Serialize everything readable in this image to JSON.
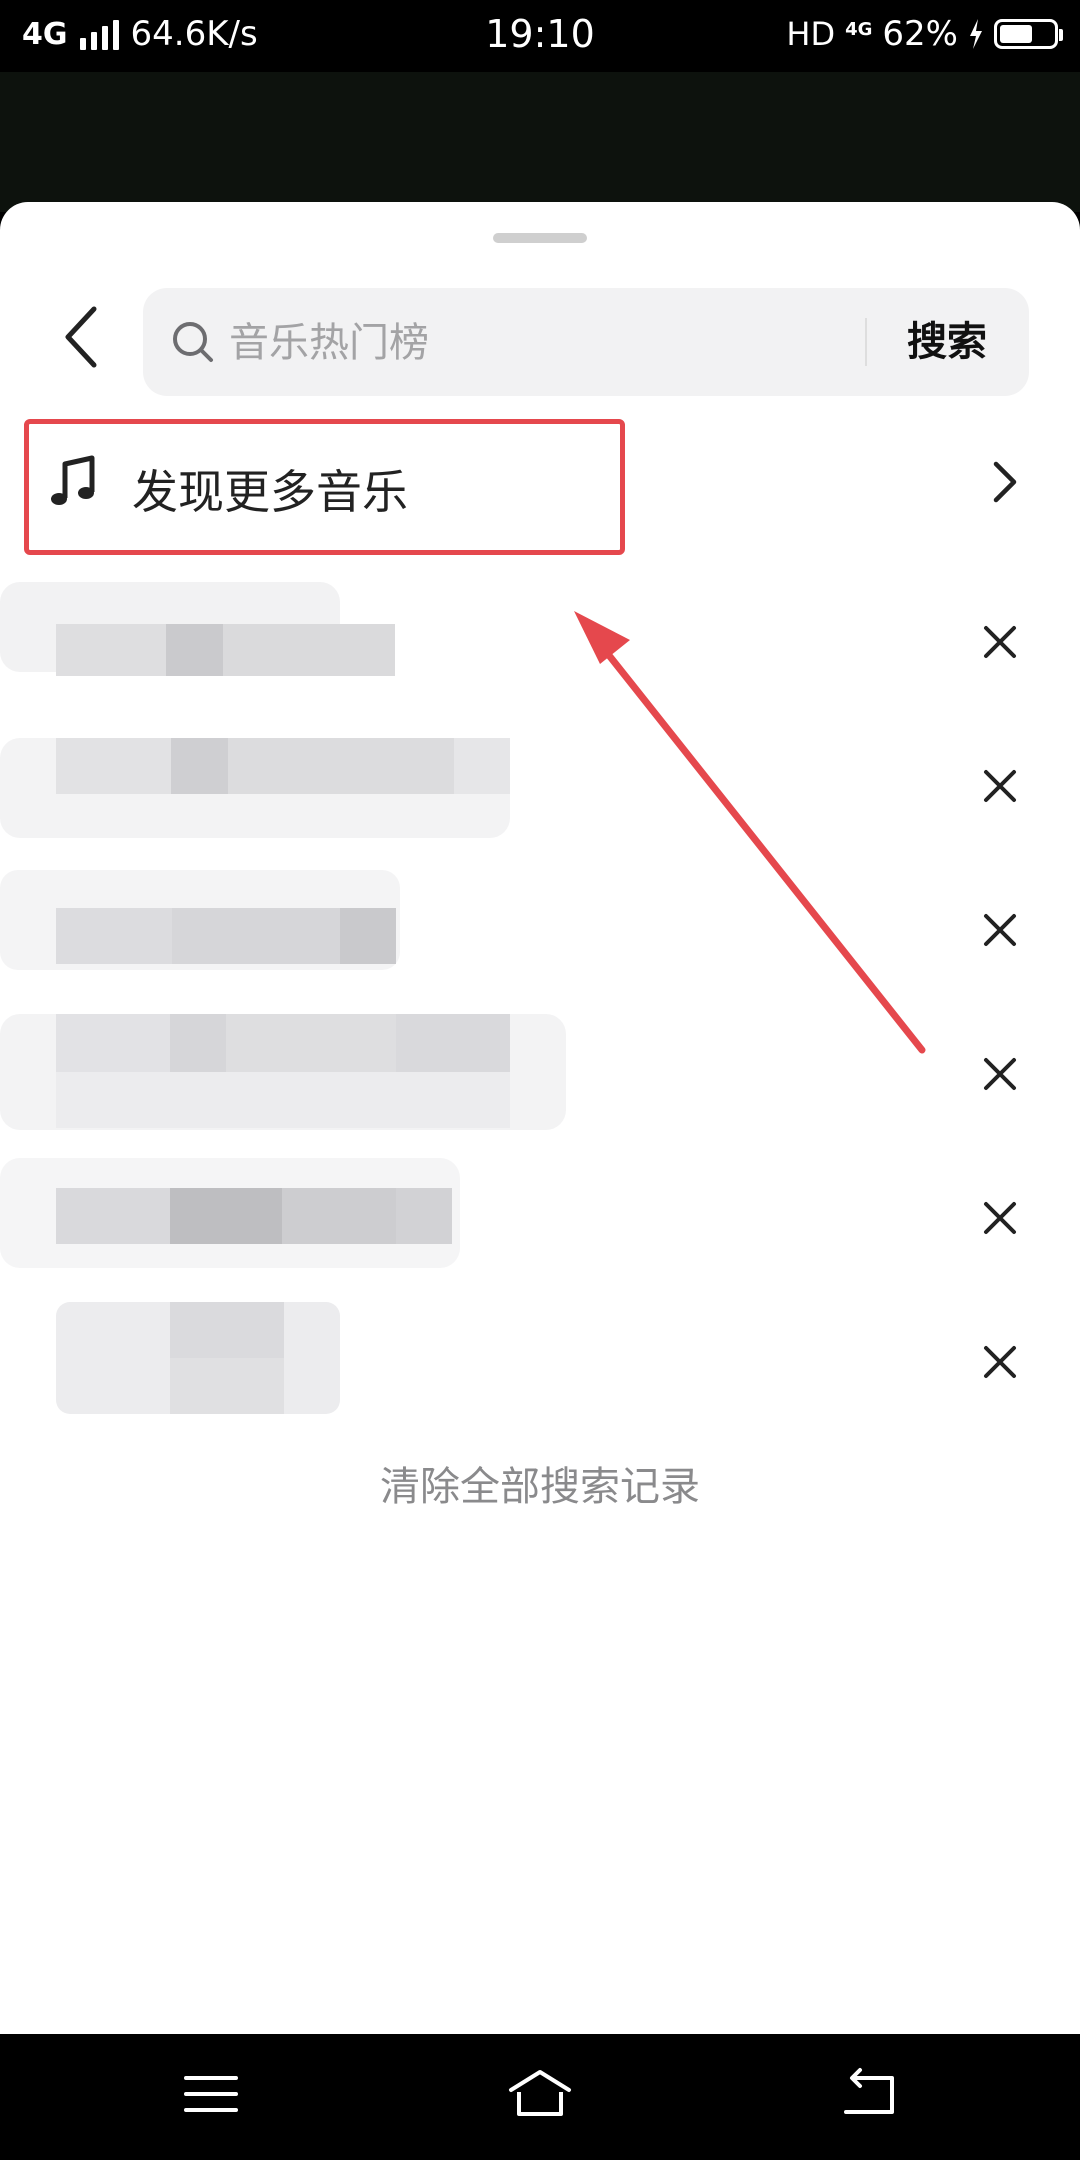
{
  "status_bar": {
    "network": "4G",
    "speed": "64.6K/s",
    "time": "19:10",
    "hd": "HD",
    "network_right": "4G",
    "battery": "62%",
    "battery_level": 0.62
  },
  "search": {
    "placeholder": "音乐热门榜",
    "button_label": "搜索"
  },
  "discover": {
    "label": "发现更多音乐"
  },
  "history": {
    "items": [
      {
        "text": ""
      },
      {
        "text": ""
      },
      {
        "text": ""
      },
      {
        "text": ""
      },
      {
        "text": ""
      },
      {
        "text": ""
      }
    ],
    "clear_all_label": "清除全部搜索记录"
  },
  "colors": {
    "highlight": "#e5484d",
    "sheet_bg": "#ffffff",
    "search_bg": "#f2f2f3"
  },
  "icons": {
    "back": "chevron-left-icon",
    "search": "search-icon",
    "music": "music-note-icon",
    "chevron": "chevron-right-icon",
    "delete": "close-icon",
    "nav_menu": "menu-icon",
    "nav_home": "home-icon",
    "nav_back": "back-icon"
  }
}
